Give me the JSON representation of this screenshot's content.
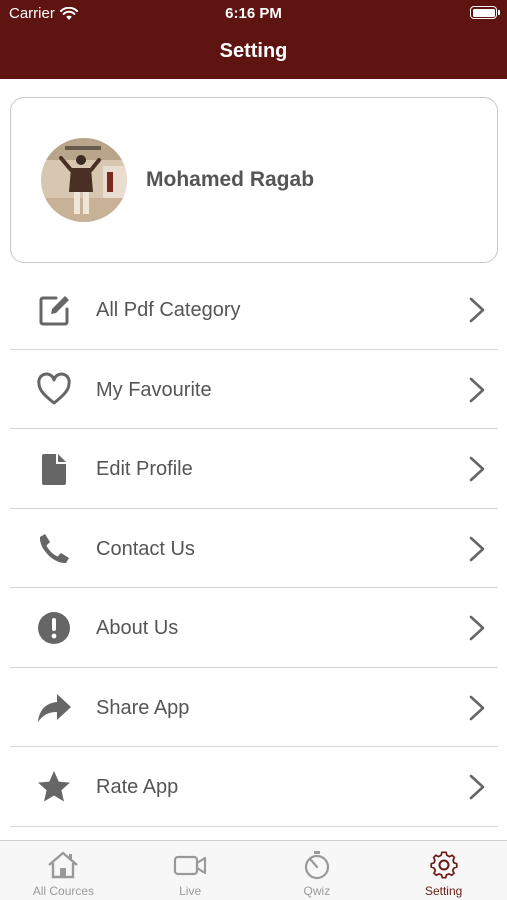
{
  "status_bar": {
    "carrier": "Carrier",
    "time": "6:16 PM"
  },
  "header": {
    "title": "Setting"
  },
  "profile": {
    "name": "Mohamed Ragab"
  },
  "menu": {
    "items": [
      {
        "label": "All Pdf Category",
        "icon": "edit-icon"
      },
      {
        "label": "My Favourite",
        "icon": "heart-icon"
      },
      {
        "label": "Edit Profile",
        "icon": "document-icon"
      },
      {
        "label": "Contact Us",
        "icon": "phone-icon"
      },
      {
        "label": "About Us",
        "icon": "info-icon"
      },
      {
        "label": "Share App",
        "icon": "share-icon"
      },
      {
        "label": "Rate App",
        "icon": "star-icon"
      }
    ]
  },
  "tabbar": {
    "tabs": [
      {
        "label": "All Cources",
        "icon": "home-icon",
        "active": false
      },
      {
        "label": "Live",
        "icon": "video-camera-icon",
        "active": false
      },
      {
        "label": "Qwiz",
        "icon": "timer-icon",
        "active": false
      },
      {
        "label": "Setting",
        "icon": "gear-icon",
        "active": true
      }
    ]
  },
  "colors": {
    "header_bg": "#5e1410",
    "accent": "#6b1a14",
    "icon_gray": "#666666",
    "text_gray": "#555555"
  }
}
